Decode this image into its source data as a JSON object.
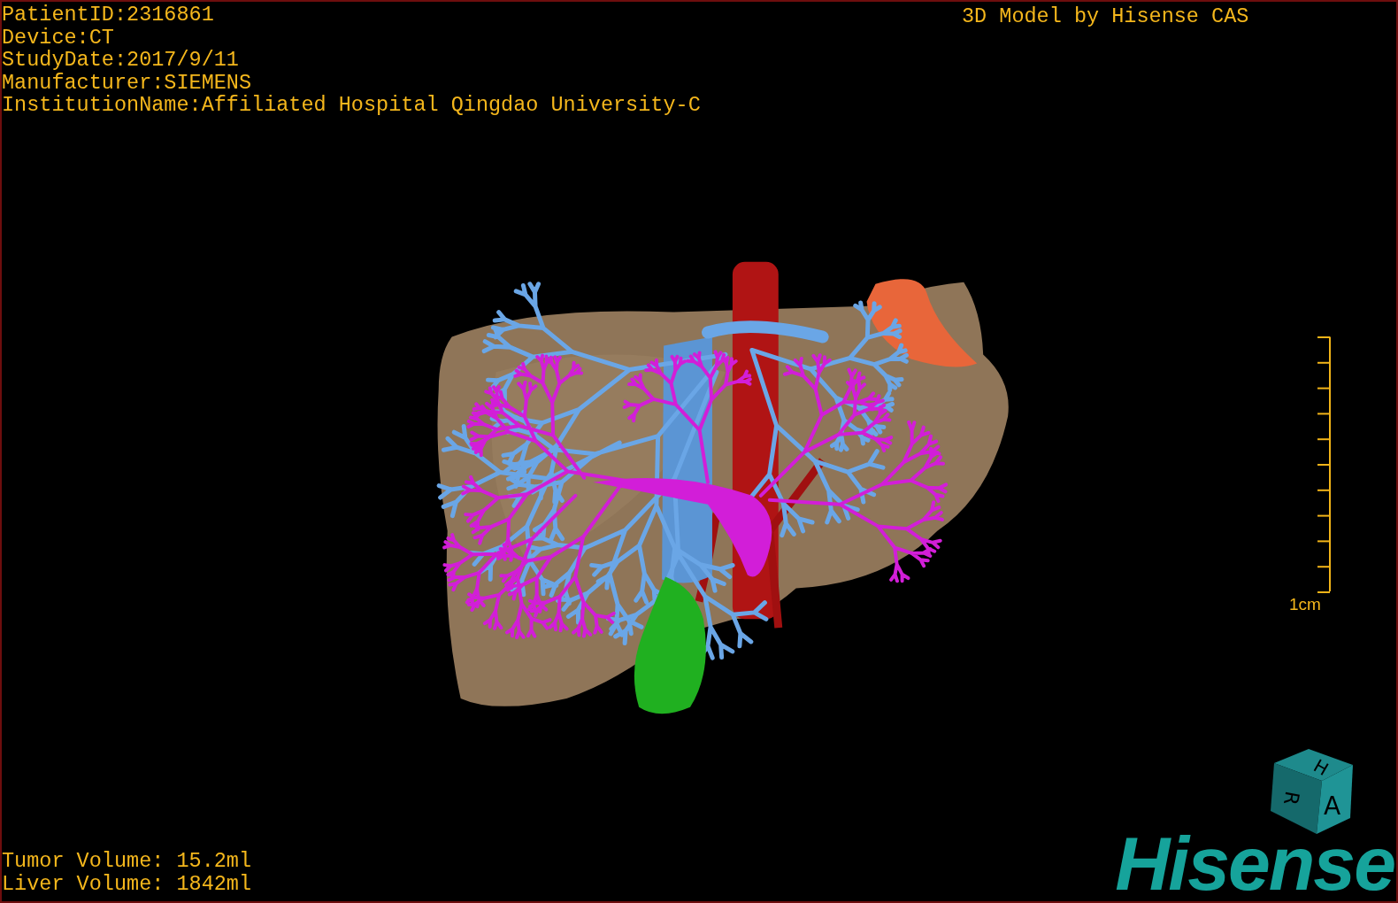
{
  "viewport": {
    "study_info": [
      "PatientID:2316861",
      "Device:CT",
      "StudyDate:2017/9/11",
      "Manufacturer:SIEMENS",
      "InstitutionName:Affiliated Hospital Qingdao University-C"
    ],
    "title": "3D Model by Hisense CAS",
    "volumes": [
      "Tumor Volume: 15.2ml",
      "Liver Volume: 1842ml"
    ],
    "scale_bar": {
      "label": "1cm"
    },
    "orientation_cube": {
      "top": "H",
      "left": "R",
      "front": "A"
    },
    "logo": "Hisense"
  }
}
